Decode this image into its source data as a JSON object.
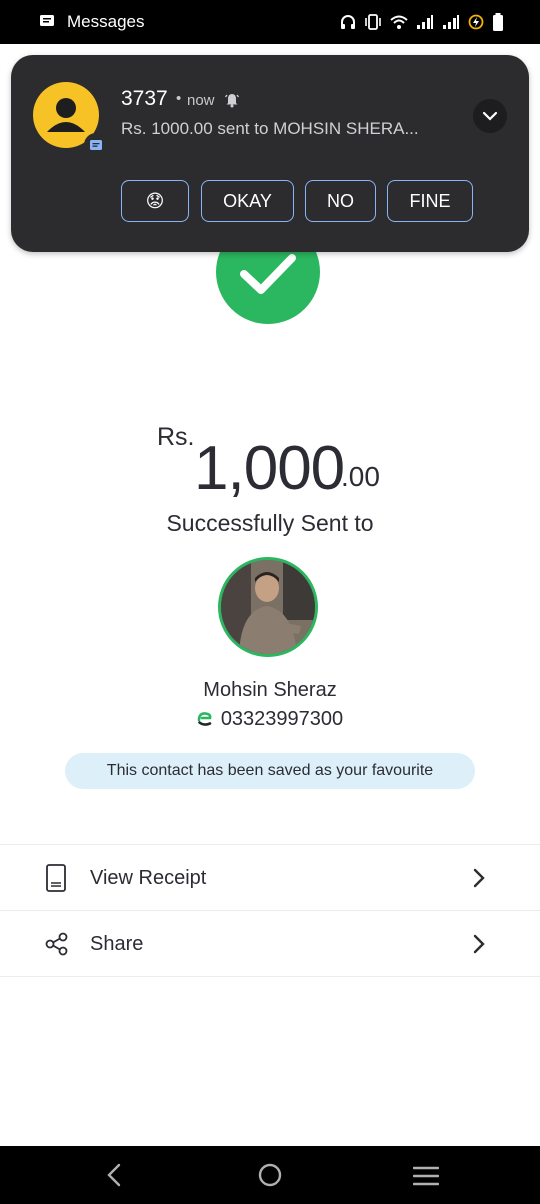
{
  "status_bar": {
    "app_name": "Messages"
  },
  "notification": {
    "sender": "3737",
    "separator": "•",
    "time": "now",
    "message": "Rs. 1000.00 sent to MOHSIN SHERA...",
    "reply_options": [
      "😟",
      "OKAY",
      "NO",
      "FINE"
    ]
  },
  "transaction": {
    "currency": "Rs.",
    "amount_whole": "1,000",
    "amount_decimal": ".00",
    "status_text": "Successfully Sent to"
  },
  "recipient": {
    "name": "Mohsin Sheraz",
    "phone": "03323997300"
  },
  "favourite_notice": "This contact has been saved as your favourite",
  "actions": [
    {
      "label": "View Receipt",
      "icon": "receipt-icon"
    },
    {
      "label": "Share",
      "icon": "share-icon"
    }
  ],
  "colors": {
    "success_green": "#2bb760",
    "notification_bg": "#2c2c2e",
    "reply_border": "#8ab4f8",
    "favourite_pill_bg": "#ddf0fa",
    "contact_avatar_yellow": "#f6c226"
  }
}
